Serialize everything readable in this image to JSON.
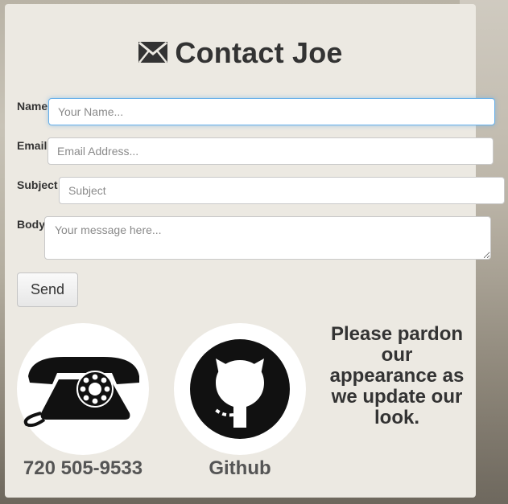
{
  "header": {
    "title": "Contact Joe",
    "icon": "envelope-icon"
  },
  "form": {
    "name": {
      "label": "Name",
      "placeholder": "Your Name..."
    },
    "email": {
      "label": "Email",
      "placeholder": "Email Address..."
    },
    "subject": {
      "label": "Subject",
      "placeholder": "Subject"
    },
    "body": {
      "label": "Body",
      "placeholder": "Your message here..."
    },
    "send_label": "Send"
  },
  "contacts": [
    {
      "icon": "telephone-icon",
      "caption": "720 505-9533"
    },
    {
      "icon": "github-icon",
      "caption": "Github"
    }
  ],
  "notice": "Please pardon our appearance as we update our look.",
  "colors": {
    "panel": "#ece9e2",
    "focus_border": "#66afe9",
    "text": "#333333"
  }
}
